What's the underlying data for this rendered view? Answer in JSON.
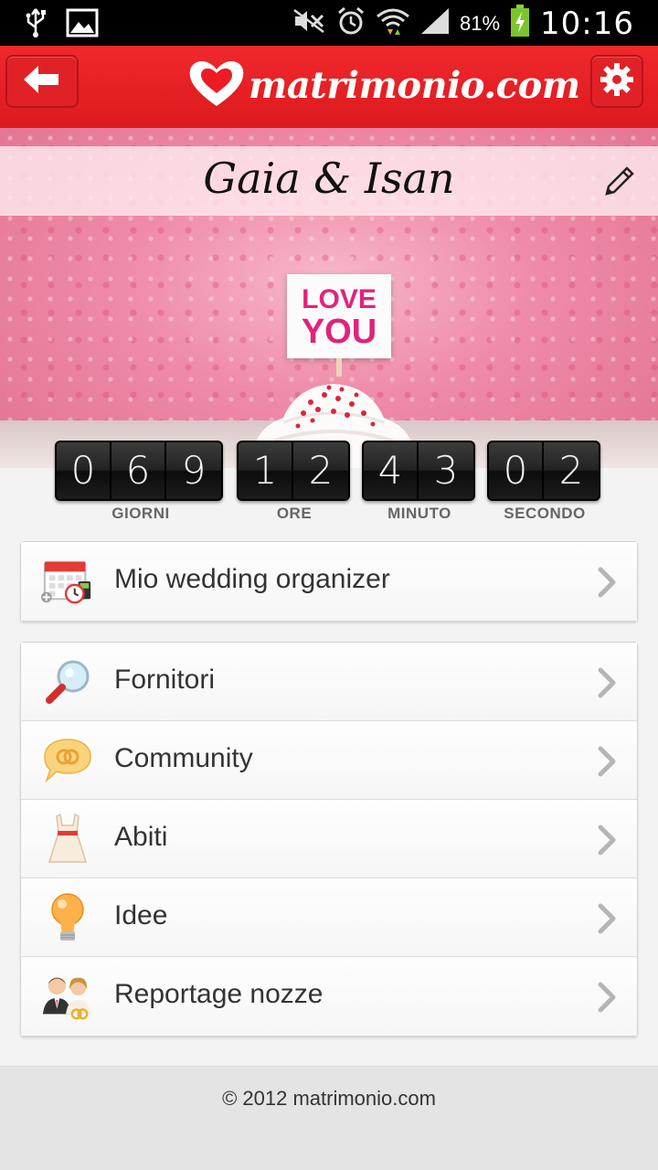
{
  "status_bar": {
    "battery_percent": "81%",
    "time": "10:16",
    "icons": [
      "usb-icon",
      "image-icon",
      "muted-icon",
      "alarm-icon",
      "wifi-icon",
      "signal-icon",
      "battery-charging-icon"
    ]
  },
  "header": {
    "logo_text": "matrimonio.com",
    "back_icon": "arrow-left-icon",
    "settings_icon": "gear-icon",
    "brand_color": "#ed1c24"
  },
  "hero": {
    "couple_name": "Gaia & Isan",
    "card_line1": "LOVE",
    "card_line2": "YOU",
    "edit_icon": "pencil-icon"
  },
  "countdown": {
    "groups": [
      {
        "digits": [
          "0",
          "6",
          "9"
        ],
        "label": "GIORNI"
      },
      {
        "digits": [
          "1",
          "2"
        ],
        "label": "ORE"
      },
      {
        "digits": [
          "4",
          "3"
        ],
        "label": "MINUTO"
      },
      {
        "digits": [
          "0",
          "2"
        ],
        "label": "SECONDO"
      }
    ]
  },
  "menu": {
    "organizer": {
      "label": "Mio wedding organizer",
      "icon": "calendar-icon"
    },
    "items": [
      {
        "label": "Fornitori",
        "icon": "magnifier-icon"
      },
      {
        "label": "Community",
        "icon": "speech-bubble-icon"
      },
      {
        "label": "Abiti",
        "icon": "dress-icon"
      },
      {
        "label": "Idee",
        "icon": "lightbulb-icon"
      },
      {
        "label": "Reportage nozze",
        "icon": "couple-icon"
      }
    ]
  },
  "footer": {
    "text": "© 2012 matrimonio.com"
  }
}
